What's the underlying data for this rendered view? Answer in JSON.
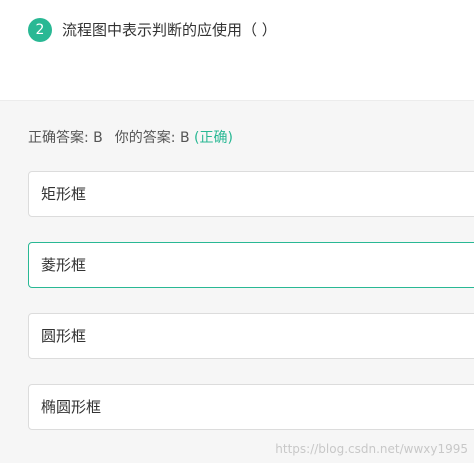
{
  "question": {
    "number": "2",
    "text": "流程图中表示判断的应使用（ ）"
  },
  "answer": {
    "correct_label": "正确答案: B",
    "your_label": "你的答案: B",
    "status": "(正确)"
  },
  "options": [
    {
      "label": "矩形框"
    },
    {
      "label": "菱形框"
    },
    {
      "label": "圆形框"
    },
    {
      "label": "椭圆形框"
    }
  ],
  "watermark": "https://blog.csdn.net/wwxy1995",
  "colors": {
    "accent": "#29b894",
    "panel_bg": "#f6f6f6",
    "option_border": "#dcdcdc"
  }
}
